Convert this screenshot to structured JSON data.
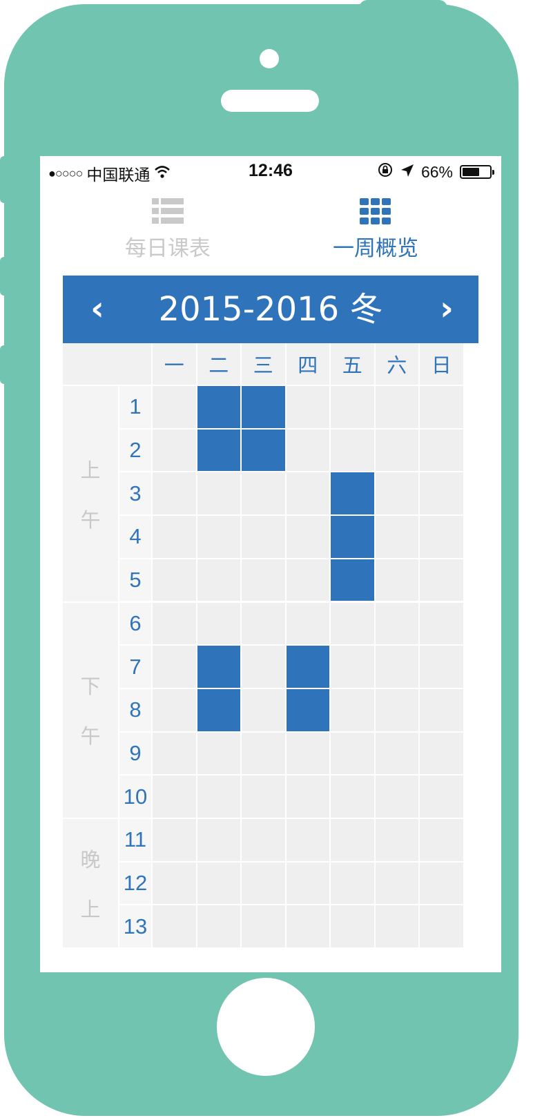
{
  "status_bar": {
    "signal": "●○○○○",
    "carrier": "中国联通",
    "time": "12:46",
    "battery_percent": "66%",
    "battery_level": 0.66
  },
  "tabs": [
    {
      "label": "每日课表",
      "icon": "list-icon",
      "active": false
    },
    {
      "label": "一周概览",
      "icon": "grid-icon",
      "active": true
    }
  ],
  "term": {
    "title": "2015-2016 冬",
    "prev": "‹",
    "next": "›"
  },
  "days": [
    "一",
    "二",
    "三",
    "四",
    "五",
    "六",
    "日"
  ],
  "periods": [
    {
      "label": [
        "上",
        "午"
      ],
      "rows": [
        "1",
        "2",
        "3",
        "4",
        "5"
      ]
    },
    {
      "label": [
        "下",
        "午"
      ],
      "rows": [
        "6",
        "7",
        "8",
        "9",
        "10"
      ]
    },
    {
      "label": [
        "晚",
        "上"
      ],
      "rows": [
        "11",
        "12",
        "13"
      ]
    }
  ],
  "schedule": [
    [
      0,
      1,
      1,
      0,
      0,
      0,
      0
    ],
    [
      0,
      1,
      1,
      0,
      0,
      0,
      0
    ],
    [
      0,
      0,
      0,
      0,
      1,
      0,
      0
    ],
    [
      0,
      0,
      0,
      0,
      1,
      0,
      0
    ],
    [
      0,
      0,
      0,
      0,
      1,
      0,
      0
    ],
    [
      0,
      0,
      0,
      0,
      0,
      0,
      0
    ],
    [
      0,
      1,
      0,
      1,
      0,
      0,
      0
    ],
    [
      0,
      1,
      0,
      1,
      0,
      0,
      0
    ],
    [
      0,
      0,
      0,
      0,
      0,
      0,
      0
    ],
    [
      0,
      0,
      0,
      0,
      0,
      0,
      0
    ],
    [
      0,
      0,
      0,
      0,
      0,
      0,
      0
    ],
    [
      0,
      0,
      0,
      0,
      0,
      0,
      0
    ],
    [
      0,
      0,
      0,
      0,
      0,
      0,
      0
    ]
  ],
  "colors": {
    "accent": "#2f74bb",
    "phone": "#71c4b0",
    "inactive": "#c9c9c9"
  }
}
